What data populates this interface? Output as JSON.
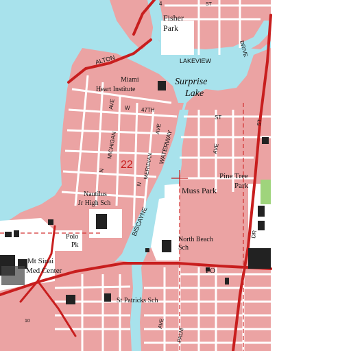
{
  "colors": {
    "water": "#a8e2ec",
    "urban": "#eba3a3",
    "urban_dark": "#d98a8a",
    "street": "#ffffff",
    "street_casing": "#1a1a1a",
    "highway": "#c81e1e",
    "park": "#ffffff",
    "green": "#9fd47c",
    "outside": "#ffffff",
    "building": "#222222",
    "section_line": "#d23030"
  },
  "labels": {
    "fisher_park_1": "Fisher",
    "fisher_park_2": "Park",
    "lakeview": "LAKEVIEW",
    "drive": "DRIVE",
    "surprise_1": "Surprise",
    "surprise_2": "Lake",
    "alton": "ALTON",
    "miami_heart_1": "Miami",
    "miami_heart_2": "Heart Institute",
    "w": "W",
    "w47th": "47TH",
    "st_a": "ST",
    "st_b": "ST",
    "st_top": "ST",
    "four": "4",
    "n_michigan_1": "N",
    "n_michigan_2": "MICHIGAN",
    "n_michigan_3": "AVE",
    "meridian_1": "N",
    "meridian_2": "MERIDIAN",
    "meridian_3": "AVE",
    "waterway": "WATERWAY",
    "biscayne": "BISCAYNE",
    "section": "22",
    "ave_1": "AVE",
    "pine_tree_1": "Pine Tree",
    "pine_tree_2": "Park",
    "muss_park": "Muss Park",
    "nautilus_1": "Nautilus",
    "nautilus_2": "Jr High Sch",
    "polo_1": "Polo",
    "polo_2": "Pk",
    "north_beach_1": "North Beach",
    "north_beach_2": "Sch",
    "dr": "DR",
    "mt_sinai_1": "Mt Sinai",
    "mt_sinai_2": "Med Center",
    "po": "PO",
    "st_patricks": "St Patricks Sch",
    "ave_2": "AVE",
    "palm": "PALM",
    "elev_10": "10"
  }
}
